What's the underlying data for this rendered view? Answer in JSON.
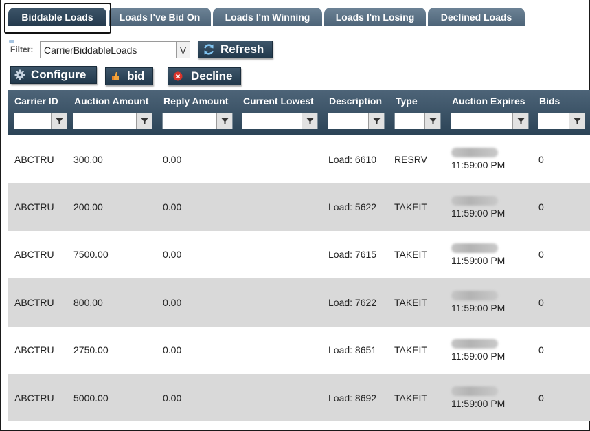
{
  "tabs": [
    {
      "label": "Biddable Loads",
      "active": true
    },
    {
      "label": "Loads I've Bid On",
      "active": false
    },
    {
      "label": "Loads I'm Winning",
      "active": false
    },
    {
      "label": "Loads I'm Losing",
      "active": false
    },
    {
      "label": "Declined Loads",
      "active": false
    }
  ],
  "filter": {
    "label": "Filter:",
    "value": "CarrierBiddableLoads",
    "arrow": "V"
  },
  "toolbar": {
    "refresh_label": "Refresh",
    "configure_label": "Configure",
    "bid_label": "bid",
    "decline_label": "Decline"
  },
  "grid": {
    "columns": [
      "Carrier ID",
      "Auction Amount",
      "Reply Amount",
      "Current Lowest",
      "Description",
      "Type",
      "Auction Expires",
      "Bids"
    ],
    "rows": [
      {
        "carrier_id": "ABCTRU",
        "auction_amount": "300.00",
        "reply_amount": "0.00",
        "current_lowest": "",
        "description": "Load: 6610",
        "type": "RESRV",
        "expires_time": "11:59:00 PM",
        "bids": "0"
      },
      {
        "carrier_id": "ABCTRU",
        "auction_amount": "200.00",
        "reply_amount": "0.00",
        "current_lowest": "",
        "description": "Load: 5622",
        "type": "TAKEIT",
        "expires_time": "11:59:00 PM",
        "bids": "0"
      },
      {
        "carrier_id": "ABCTRU",
        "auction_amount": "7500.00",
        "reply_amount": "0.00",
        "current_lowest": "",
        "description": "Load: 7615",
        "type": "TAKEIT",
        "expires_time": "11:59:00 PM",
        "bids": "0"
      },
      {
        "carrier_id": "ABCTRU",
        "auction_amount": "800.00",
        "reply_amount": "0.00",
        "current_lowest": "",
        "description": "Load: 7622",
        "type": "TAKEIT",
        "expires_time": "11:59:00 PM",
        "bids": "0"
      },
      {
        "carrier_id": "ABCTRU",
        "auction_amount": "2750.00",
        "reply_amount": "0.00",
        "current_lowest": "",
        "description": "Load: 8651",
        "type": "TAKEIT",
        "expires_time": "11:59:00 PM",
        "bids": "0"
      },
      {
        "carrier_id": "ABCTRU",
        "auction_amount": "5000.00",
        "reply_amount": "0.00",
        "current_lowest": "",
        "description": "Load: 8692",
        "type": "TAKEIT",
        "expires_time": "11:59:00 PM",
        "bids": "0"
      }
    ]
  },
  "icons": {
    "refresh": "refresh-icon",
    "configure": "gear-icon",
    "bid": "bid-icon",
    "decline": "decline-icon",
    "filter": "funnel-icon"
  },
  "colors": {
    "tab": "#5a7185",
    "tab_active": "#2f4659",
    "header": "#3a5163",
    "row_alt": "#d9d9d9",
    "decline_red": "#d9342b"
  }
}
